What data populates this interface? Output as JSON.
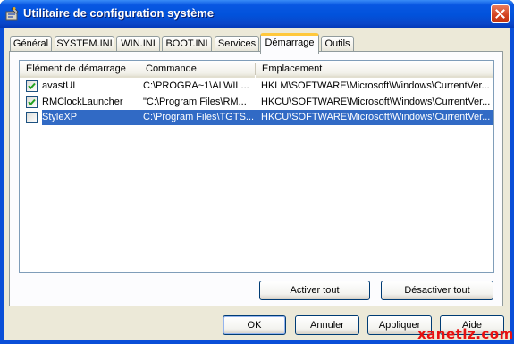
{
  "window": {
    "title": "Utilitaire de configuration système",
    "icon": "msconfig-app-icon",
    "close_icon": "close-icon"
  },
  "tabs": [
    {
      "label": "Général",
      "active": false
    },
    {
      "label": "SYSTEM.INI",
      "active": false
    },
    {
      "label": "WIN.INI",
      "active": false
    },
    {
      "label": "BOOT.INI",
      "active": false
    },
    {
      "label": "Services",
      "active": false
    },
    {
      "label": "Démarrage",
      "active": true
    },
    {
      "label": "Outils",
      "active": false
    }
  ],
  "startup_list": {
    "columns": [
      "Élément de démarrage",
      "Commande",
      "Emplacement"
    ],
    "rows": [
      {
        "checked": true,
        "item": "avastUI",
        "command": "C:\\PROGRA~1\\ALWIL...",
        "location": "HKLM\\SOFTWARE\\Microsoft\\Windows\\CurrentVer...",
        "selected": false
      },
      {
        "checked": true,
        "item": "RMClockLauncher",
        "command": "\"C:\\Program Files\\RM...",
        "location": "HKCU\\SOFTWARE\\Microsoft\\Windows\\CurrentVer...",
        "selected": false
      },
      {
        "checked": false,
        "item": "StyleXP",
        "command": "C:\\Program Files\\TGTS...",
        "location": "HKCU\\SOFTWARE\\Microsoft\\Windows\\CurrentVer...",
        "selected": true
      }
    ]
  },
  "panel_buttons": {
    "enable_all": "Activer tout",
    "disable_all": "Désactiver tout"
  },
  "dialog_buttons": {
    "ok": "OK",
    "cancel": "Annuler",
    "apply": "Appliquer",
    "help": "Aide"
  },
  "watermark": "xanetlz.com",
  "colors": {
    "titlebar": "#0152db",
    "selection": "#316ac5",
    "active_tab_accent": "#ffc83c",
    "checkmark": "#21a121",
    "watermark": "#e81010"
  }
}
